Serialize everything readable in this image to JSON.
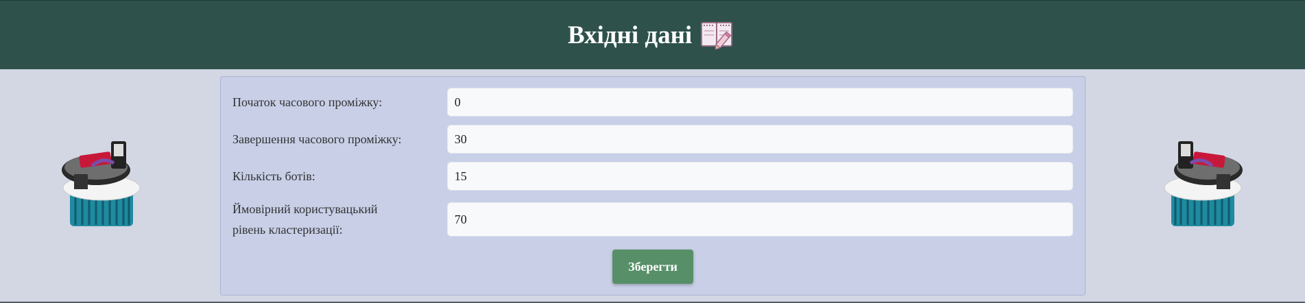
{
  "header": {
    "title": "Вхідні дані",
    "icon": "notebook-pencil-icon"
  },
  "form": {
    "fields": [
      {
        "label": "Початок часового проміжку:",
        "value": "0"
      },
      {
        "label": "Завершення часового проміжку:",
        "value": "30"
      },
      {
        "label": "Кількість ботів:",
        "value": "15"
      },
      {
        "label_line1": "Ймовірний користувацький",
        "label_line2": "рівень кластеризації:",
        "value": "70"
      }
    ],
    "save_label": "Зберегти"
  },
  "decor": {
    "left_image": "robot-vacuum-image",
    "right_image": "robot-vacuum-image"
  },
  "colors": {
    "header_bg": "#2e514b",
    "page_bg": "#d3d7e3",
    "panel_bg": "#c8cfe7",
    "button_bg": "#579068"
  }
}
